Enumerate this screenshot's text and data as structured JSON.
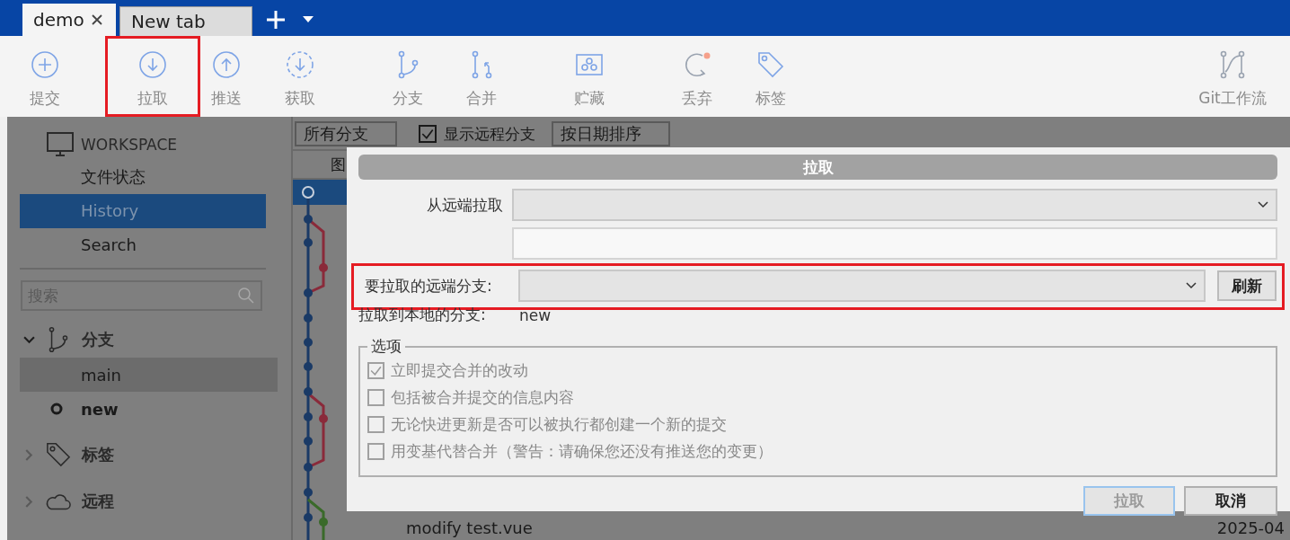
{
  "tabs": [
    {
      "label": "demo",
      "selected": true,
      "closable": true
    },
    {
      "label": "New tab",
      "selected": false,
      "closable": false
    }
  ],
  "toolbar": {
    "groups": [
      [
        {
          "label": "提交",
          "kind": "commit",
          "highlighted": false
        }
      ],
      [
        {
          "label": "拉取",
          "kind": "pull",
          "highlighted": true
        },
        {
          "label": "推送",
          "kind": "push",
          "highlighted": false
        },
        {
          "label": "获取",
          "kind": "fetch",
          "highlighted": false
        }
      ],
      [
        {
          "label": "分支",
          "kind": "branch",
          "highlighted": false
        },
        {
          "label": "合并",
          "kind": "merge",
          "highlighted": false
        }
      ],
      [
        {
          "label": "贮藏",
          "kind": "stash",
          "highlighted": false
        }
      ],
      [
        {
          "label": "丢弃",
          "kind": "discard",
          "highlighted": false
        },
        {
          "label": "标签",
          "kind": "tag",
          "highlighted": false
        }
      ]
    ],
    "right": {
      "label": "Git工作流",
      "kind": "flow",
      "highlighted": false
    }
  },
  "sidebar": {
    "workspace": "WORKSPACE",
    "items": [
      {
        "label": "文件状态",
        "selected": false
      },
      {
        "label": "History",
        "selected": true
      },
      {
        "label": "Search",
        "selected": false
      }
    ],
    "search": {
      "placeholder": "搜索"
    },
    "sections": [
      {
        "label": "分支",
        "kind": "branch",
        "expanded": true,
        "children": [
          {
            "name": "main",
            "selected": true,
            "current": false
          },
          {
            "name": "new",
            "selected": false,
            "current": true
          }
        ]
      },
      {
        "label": "标签",
        "kind": "tag",
        "expanded": false
      },
      {
        "label": "远程",
        "kind": "cloud",
        "expanded": false
      }
    ]
  },
  "filters": {
    "branches": "所有分支",
    "show_remote": {
      "label": "显示远程分支",
      "checked": true
    },
    "sort": "按日期排序"
  },
  "columns": [
    "图"
  ],
  "commits": [
    {
      "selected": true
    },
    {
      "subject": "modify test.vue",
      "date": "2025-04",
      "selected": false
    }
  ],
  "dialog": {
    "title": "拉取",
    "remote_label": "从远端拉取",
    "branch_row": {
      "label": "要拉取的远端分支:",
      "refresh": "刷新",
      "highlighted": true
    },
    "local_label": "拉取到本地的分支:",
    "local_value": "new",
    "options_title": "选项",
    "options": [
      {
        "label": "立即提交合并的改动",
        "checked": true,
        "disabled": true
      },
      {
        "label": "包括被合并提交的信息内容",
        "checked": false,
        "disabled": true
      },
      {
        "label": "无论快进更新是否可以被执行都创建一个新的提交",
        "checked": false,
        "disabled": true
      },
      {
        "label": "用变基代替合并（警告：请确保您还没有推送您的变更）",
        "checked": false,
        "disabled": true
      }
    ],
    "buttons": [
      {
        "label": "拉取",
        "kind": "ok",
        "disabled": true
      },
      {
        "label": "取消",
        "kind": "cancel",
        "disabled": false
      }
    ]
  }
}
